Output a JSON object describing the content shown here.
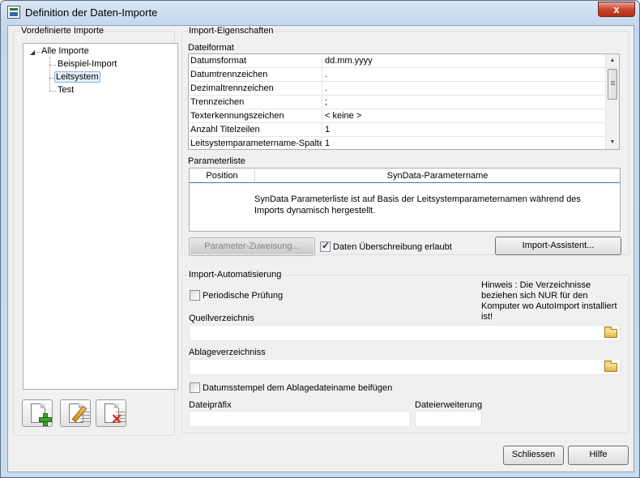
{
  "window": {
    "title": "Definition der Daten-Importe",
    "close_glyph": "x"
  },
  "left_panel": {
    "group_label": "Vordefinierte Importe",
    "tree": {
      "root_label": "Alle Importe",
      "root_glyph": "◢",
      "items": [
        {
          "label": "Beispiel-Import"
        },
        {
          "label": "Leitsystem"
        },
        {
          "label": "Test"
        }
      ]
    },
    "icons": [
      "new-document-icon",
      "edit-document-icon",
      "delete-document-icon"
    ]
  },
  "properties": {
    "group_label": "Import-Eigenschaften",
    "file_format_label": "Dateiformat",
    "rows": [
      {
        "key": "Datumsformat",
        "value": "dd.mm.yyyy"
      },
      {
        "key": "Datumtrennzeichen",
        "value": "."
      },
      {
        "key": "Dezimaltrennzeichen",
        "value": "."
      },
      {
        "key": "Trennzeichen",
        "value": ";"
      },
      {
        "key": "Texterkennungszeichen",
        "value": "< keine >"
      },
      {
        "key": "Anzahl Titelzeilen",
        "value": "1"
      },
      {
        "key": "Leitsystemparametername-Spalte",
        "value": "1"
      }
    ],
    "scroll_up": "▲",
    "scroll_down": "▼",
    "parameter_list_label": "Parameterliste",
    "columns": [
      "Position",
      "SynData-Parametername"
    ],
    "list_message": "SynData Parameterliste ist auf Basis der Leitsystemparameternamen während des Imports dynamisch hergestellt.",
    "param_assign_button": "Parameter-Zuweisung...",
    "overwrite_checkbox": {
      "label": "Daten Überschreibung erlaubt",
      "checked": true
    },
    "import_assistant_button": "Import-Assistent..."
  },
  "automation": {
    "group_label": "Import-Automatisierung",
    "periodic_check": {
      "label": "Periodische Prüfung",
      "checked": false
    },
    "hint": "Hinweis : Die Verzeichnisse beziehen sich NUR für den Komputer wo AutoImport installiert ist!",
    "source_dir_label": "Quellverzeichnis",
    "source_dir_value": "",
    "archive_dir_label": "Ablageverzeichniss",
    "archive_dir_value": "",
    "timestamp_checkbox": {
      "label": "Datumsstempel dem Ablagedateiname beifügen",
      "checked": false
    },
    "file_prefix_label": "Dateipräfix",
    "file_prefix_value": "",
    "file_extension_label": "Dateierweiterung",
    "file_extension_value": ""
  },
  "footer": {
    "close_button": "Schliessen",
    "help_button": "Hilfe"
  }
}
